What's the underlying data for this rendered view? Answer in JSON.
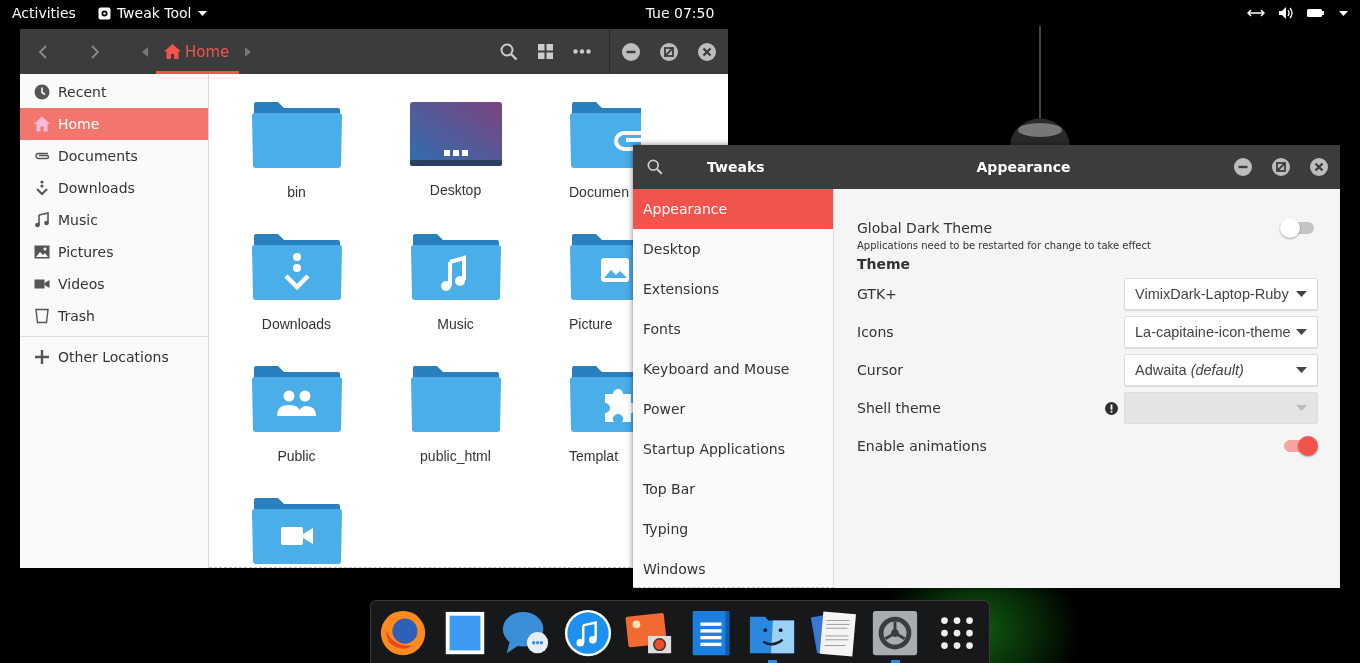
{
  "top_bar": {
    "activities": "Activities",
    "app_menu": "Tweak Tool",
    "clock": "Tue 07:50"
  },
  "files_window": {
    "path": [
      {
        "label": "Home",
        "selected": true
      }
    ],
    "sidebar": [
      {
        "kind": "clock",
        "label": "Recent",
        "selected": false
      },
      {
        "kind": "home",
        "label": "Home",
        "selected": true
      },
      {
        "kind": "clip",
        "label": "Documents",
        "selected": false
      },
      {
        "kind": "download",
        "label": "Downloads",
        "selected": false
      },
      {
        "kind": "music",
        "label": "Music",
        "selected": false
      },
      {
        "kind": "picture",
        "label": "Pictures",
        "selected": false
      },
      {
        "kind": "video",
        "label": "Videos",
        "selected": false
      },
      {
        "kind": "trash",
        "label": "Trash",
        "selected": false
      }
    ],
    "other_locations": "Other Locations",
    "folders": [
      {
        "kind": "plain",
        "name": "bin"
      },
      {
        "kind": "desktop",
        "name": "Desktop"
      },
      {
        "kind": "clip",
        "name": "Documen"
      },
      {
        "kind": "download",
        "name": "Downloads"
      },
      {
        "kind": "music",
        "name": "Music"
      },
      {
        "kind": "picture",
        "name": "Picture"
      },
      {
        "kind": "people",
        "name": "Public"
      },
      {
        "kind": "plain",
        "name": "public_html"
      },
      {
        "kind": "puzzle",
        "name": "Templat"
      },
      {
        "kind": "video"
      }
    ]
  },
  "tweaks_window": {
    "title": "Tweaks",
    "page_title": "Appearance",
    "sidebar": [
      {
        "label": "Appearance",
        "selected": true
      },
      {
        "label": "Desktop",
        "selected": false
      },
      {
        "label": "Extensions",
        "selected": false
      },
      {
        "label": "Fonts",
        "selected": false
      },
      {
        "label": "Keyboard and Mouse",
        "selected": false
      },
      {
        "label": "Power",
        "selected": false
      },
      {
        "label": "Startup Applications",
        "selected": false
      },
      {
        "label": "Top Bar",
        "selected": false
      },
      {
        "label": "Typing",
        "selected": false
      },
      {
        "label": "Windows",
        "selected": false
      }
    ],
    "settings": [
      {
        "kind": "switch",
        "label": "Global Dark Theme",
        "on": false,
        "note": "Applications need to be restarted for change to take effect"
      },
      {
        "kind": "heading",
        "label": "Theme"
      },
      {
        "kind": "dropdown",
        "label": "GTK+",
        "value": "VimixDark-Laptop-Ruby",
        "disabled": false
      },
      {
        "kind": "dropdown",
        "label": "Icons",
        "value": "La-capitaine-icon-theme",
        "disabled": false
      },
      {
        "kind": "dropdown",
        "label": "Cursor",
        "value": "Adwaita *(default)*",
        "disabled": false
      },
      {
        "kind": "dropdown",
        "label": "Shell theme",
        "disabled": true,
        "warning": true
      },
      {
        "kind": "switch",
        "label": "Enable animations",
        "on": true
      }
    ]
  },
  "dock": [
    {
      "kind": "browser",
      "running": false
    },
    {
      "kind": "stamp",
      "running": false
    },
    {
      "kind": "chat",
      "running": false
    },
    {
      "kind": "music",
      "running": false
    },
    {
      "kind": "photos",
      "running": false
    },
    {
      "kind": "book",
      "running": false
    },
    {
      "kind": "finder",
      "running": true
    },
    {
      "kind": "notes",
      "running": false
    },
    {
      "kind": "settings",
      "running": true
    },
    {
      "kind": "apps",
      "running": false
    }
  ]
}
